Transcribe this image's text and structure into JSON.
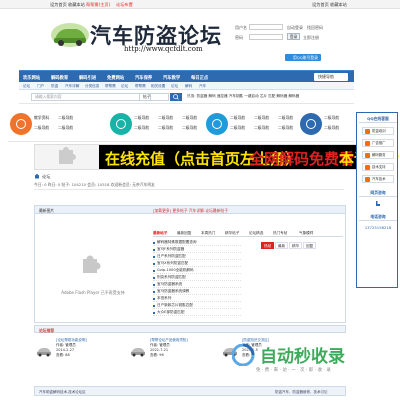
{
  "topbar": {
    "links": [
      "设为首页",
      "收藏本站",
      "帮帮需(主页)",
      "论坛布置"
    ],
    "right_links": [
      "设为首页",
      "收藏本站"
    ]
  },
  "logo": {
    "title": "汽车防盗论坛",
    "url": "http://www.qcfdlt.com"
  },
  "login": {
    "user_label": "用户名",
    "pass_label": "密码",
    "auto_login": "自动登录",
    "forgot": "找回密码",
    "login_btn": "登录",
    "register": "立即注册",
    "qq_login": "用QQ账号登录"
  },
  "nav": {
    "items": [
      "欢乐网站",
      "解码教育",
      "解码引进",
      "免费网站",
      "汽车保养",
      "汽车教学",
      "每日正点"
    ],
    "quick": "快捷导航"
  },
  "subnav": {
    "items": [
      "论坛",
      "门户",
      "防盗",
      "汽车详解",
      "分类信息",
      "帮帮需",
      "论坛",
      "帮帮需",
      "相关设置",
      "论坛",
      "解码",
      "汽车"
    ]
  },
  "search": {
    "placeholder": "请输入搜索内容",
    "scope": "帖子",
    "hot_label": "热搜:",
    "hot": [
      "防盗器",
      "解码",
      "遥控器",
      "汽车钥匙",
      "一键启动",
      "芯片",
      "匹配",
      "解码器",
      "解码器"
    ]
  },
  "icon_row": {
    "groups": [
      {
        "icon": "teach-icon",
        "color": "#f0732b",
        "labels": [
          "教学资料",
          "二级导航",
          "二级导航",
          "二级导航"
        ]
      },
      {
        "icon": "car-icon",
        "color": "#17b3a7",
        "labels": [
          "二级导航",
          "二级导航",
          "二级导航",
          "二级导航",
          "二级导航",
          "二级导航"
        ]
      },
      {
        "icon": "forum-icon",
        "color": "#1e9bd8",
        "labels": [
          "二级导航",
          "二级导航",
          "二级导航",
          "二级导航",
          "二级导航",
          "二级导航"
        ]
      },
      {
        "icon": "star-icon",
        "color": "#2d6ab0",
        "labels": [
          "二级导航",
          "二级导航",
          "二级导航",
          "二级导航"
        ]
      }
    ]
  },
  "banner": {
    "text1": "在线充值（点击首页左上角）",
    "text2": "全网解码免费看",
    "text3": "本论坛转"
  },
  "breadcrumb": {
    "home": "论坛"
  },
  "stats": {
    "today_label": "今日:",
    "today": "0",
    "yesterday_label": "昨日:",
    "yesterday": "0",
    "posts_label": "帖子:",
    "posts": "104210",
    "members_label": "会员:",
    "members": "10518",
    "welcome": "欢迎新会员: 无奈汽车明友"
  },
  "panel": {
    "header_left": "最新图片",
    "header_right": "[加载更多] 更多帖子 汽车详解-论坛最新帖子",
    "flash_text": "Adobe Flash Player 已不再受支持",
    "tabs": [
      "最新帖子",
      "最新回复",
      "本周热门",
      "精华帖子",
      "论坛精选",
      "热门专帖",
      "气象模样"
    ],
    "rtabs": [
      "热帖",
      "最新",
      "精华",
      "回复"
    ],
    "threads": [
      "解码器特殊数据配置查询",
      "宝马F系列防盗器",
      "日产系列防盗匹配",
      "宝马X系列防盗匹配",
      "Gvip-1000全能机解码",
      "别克系列防盗匹配",
      "宝马防盗器系统",
      "宝马防盗器系统调教",
      "本田系列",
      "日产新款芯片钥匙匹配",
      "大众E部防盗匹配"
    ]
  },
  "section": {
    "title": "论坛推荐",
    "cards": [
      {
        "title": "[论坛帮助功能说明]",
        "author": "作者: 管理员",
        "date": "2014-2-27",
        "views": "查看: 88"
      },
      {
        "title": "[帮帮论坛产品使用须知]",
        "author": "作者: 管理员",
        "date": "2022-7-21",
        "views": "查看: 96"
      },
      {
        "title": "[防盗知识交流区]",
        "author": "作者: 管理员",
        "date": "2024-1-5",
        "views": "查看: 7"
      }
    ]
  },
  "footer": {
    "left": "汽车助盗解码技术-技术论坛区",
    "right": "防盗汽车、防盗器维修、技术讨论"
  },
  "side": {
    "qq_title": "QQ在线客服",
    "items": [
      "防盗培训",
      "广告推广",
      "解码服务",
      "技术支持",
      "汽车技术"
    ],
    "service_title": "网页咨询",
    "phone_title": "电话咨询",
    "phone": "13725156218"
  },
  "watermark": {
    "brand": "自动秒收录",
    "sub": "免 · 费 · 来 · 访 · 一 · 次 · 即 · 收 · 录"
  }
}
